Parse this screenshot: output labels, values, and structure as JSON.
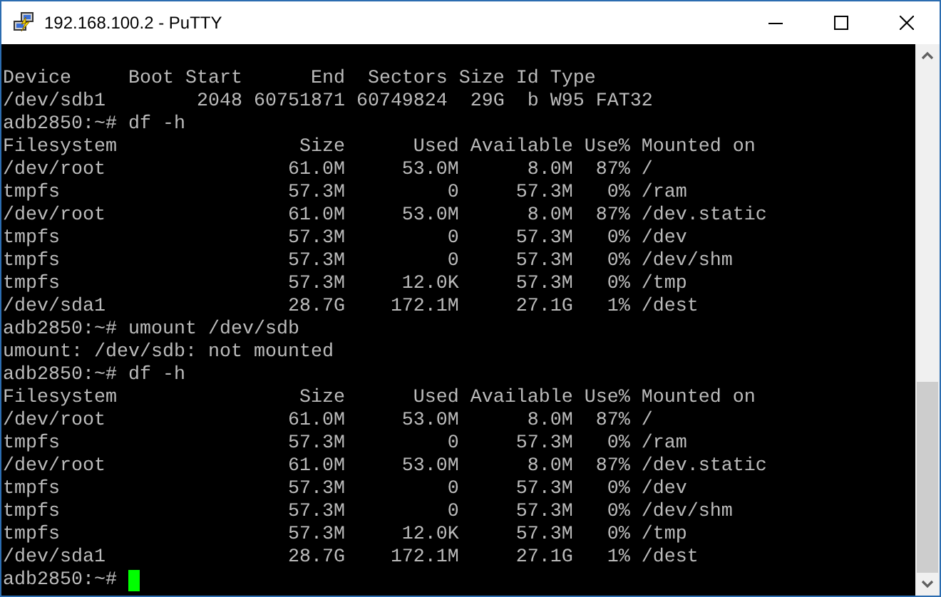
{
  "window": {
    "title": "192.168.100.2 - PuTTY"
  },
  "terminal": {
    "cursor_visible": true,
    "lines": [
      "Device     Boot Start      End  Sectors Size Id Type",
      "/dev/sdb1        2048 60751871 60749824  29G  b W95 FAT32",
      "adb2850:~# df -h",
      "Filesystem                Size      Used Available Use% Mounted on",
      "/dev/root                61.0M     53.0M      8.0M  87% /",
      "tmpfs                    57.3M         0     57.3M   0% /ram",
      "/dev/root                61.0M     53.0M      8.0M  87% /dev.static",
      "tmpfs                    57.3M         0     57.3M   0% /dev",
      "tmpfs                    57.3M         0     57.3M   0% /dev/shm",
      "tmpfs                    57.3M     12.0K     57.3M   0% /tmp",
      "/dev/sda1                28.7G    172.1M     27.1G   1% /dest",
      "adb2850:~# umount /dev/sdb",
      "umount: /dev/sdb: not mounted",
      "adb2850:~# df -h",
      "Filesystem                Size      Used Available Use% Mounted on",
      "/dev/root                61.0M     53.0M      8.0M  87% /",
      "tmpfs                    57.3M         0     57.3M   0% /ram",
      "/dev/root                61.0M     53.0M      8.0M  87% /dev.static",
      "tmpfs                    57.3M         0     57.3M   0% /dev",
      "tmpfs                    57.3M         0     57.3M   0% /dev/shm",
      "tmpfs                    57.3M     12.0K     57.3M   0% /tmp",
      "/dev/sda1                28.7G    172.1M     27.1G   1% /dest",
      "adb2850:~# "
    ]
  }
}
